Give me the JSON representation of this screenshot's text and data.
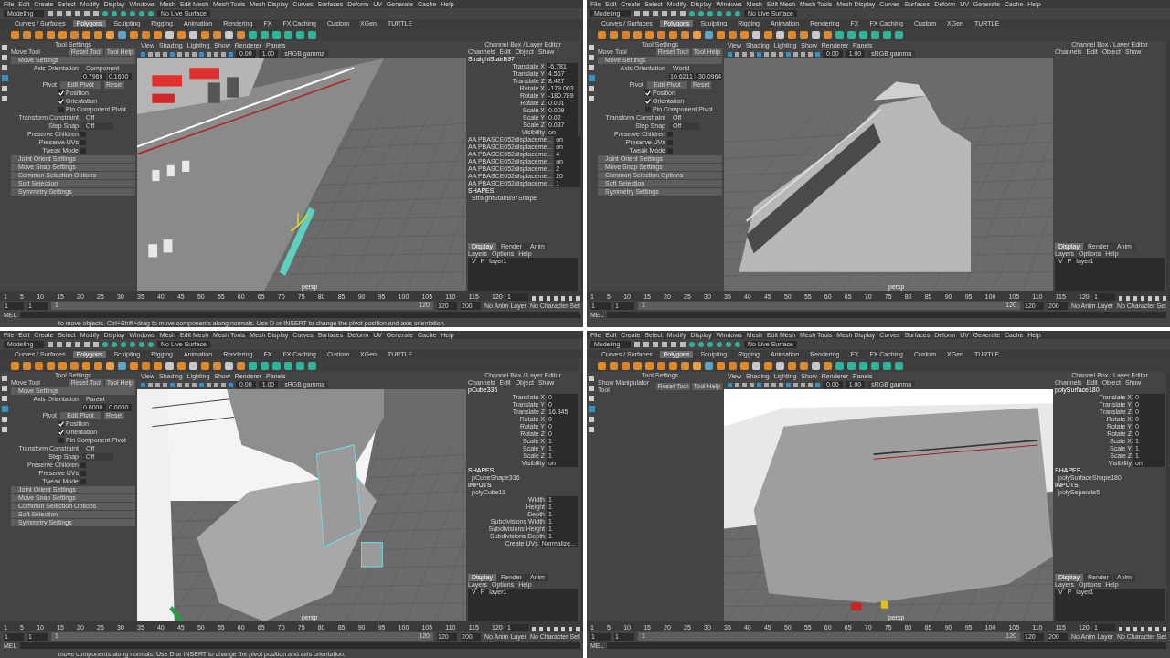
{
  "panels": [
    {
      "kind": "deck",
      "menu": [
        "File",
        "Edit",
        "Create",
        "Select",
        "Modify",
        "Display",
        "Windows",
        "Mesh",
        "Edit Mesh",
        "Mesh Tools",
        "Mesh Display",
        "Curves",
        "Surfaces",
        "Deform",
        "UV",
        "Generate",
        "Cache",
        "Help"
      ],
      "mode": "Modeling",
      "live_surface": "No Live Surface",
      "shelf_tabs": [
        {
          "label": "Curves / Surfaces",
          "selected": false
        },
        {
          "label": "Polygons",
          "selected": true
        },
        {
          "label": "Sculpting",
          "selected": false
        },
        {
          "label": "Rigging",
          "selected": false
        },
        {
          "label": "Animation",
          "selected": false
        },
        {
          "label": "Rendering",
          "selected": false
        },
        {
          "label": "FX",
          "selected": false
        },
        {
          "label": "FX Caching",
          "selected": false
        },
        {
          "label": "Custom",
          "selected": false
        },
        {
          "label": "XGen",
          "selected": false
        },
        {
          "label": "TURTLE",
          "selected": false
        }
      ],
      "tool_settings": {
        "title": "Tool Settings",
        "tool": "Move Tool",
        "buttons": [
          "Reset Tool",
          "Tool Help"
        ],
        "section": "Move Settings",
        "axis_label": "Axis Orientation",
        "axis_value": "Component",
        "axis_values": [
          "0.7969",
          "0.1600"
        ],
        "pivot_label": "Pivot",
        "pivot_buttons": [
          "Edit Pivot",
          "Reset"
        ],
        "checks": [
          {
            "label": "Position",
            "checked": true
          },
          {
            "label": "Orientation",
            "checked": true
          },
          {
            "label": "Pin Component Pivot",
            "checked": false
          }
        ],
        "constraint_label": "Transform Constraint",
        "constraint_value": "Off",
        "snap_label": "Step Snap",
        "snap_value": "Off",
        "preserve": [
          {
            "label": "Preserve Children",
            "checked": false
          },
          {
            "label": "Preserve UVs",
            "checked": false
          },
          {
            "label": "Tweak Mode",
            "checked": false
          }
        ],
        "sections": [
          "Joint Orient Settings",
          "Move Snap Settings",
          "Common Selection Options",
          "Soft Selection",
          "Symmetry Settings"
        ]
      },
      "viewport": {
        "menu": [
          "View",
          "Shading",
          "Lighting",
          "Show",
          "Renderer",
          "Panels"
        ],
        "fields": [
          "0.00",
          "1.00"
        ],
        "gamma": "sRGB gamma",
        "camera": "persp"
      },
      "channel_box": {
        "title": "Channel Box / Layer Editor",
        "menu": [
          "Channels",
          "Edit",
          "Object",
          "Show"
        ],
        "object": "StraightStairB97",
        "channels": [
          {
            "name": "Translate X",
            "value": "-6.781"
          },
          {
            "name": "Translate Y",
            "value": "4.567"
          },
          {
            "name": "Translate Z",
            "value": "8.427"
          },
          {
            "name": "Rotate X",
            "value": "-179.003"
          },
          {
            "name": "Rotate Y",
            "value": "-180.789"
          },
          {
            "name": "Rotate Z",
            "value": "0.001"
          },
          {
            "name": "Scale X",
            "value": "0.009"
          },
          {
            "name": "Scale Y",
            "value": "0.02"
          },
          {
            "name": "Scale Z",
            "value": "0.037"
          },
          {
            "name": "Visibility",
            "value": "on"
          },
          {
            "name": "AA PBASCE052displaceme...",
            "value": "on"
          },
          {
            "name": "AA PBASCE052displaceme...",
            "value": "on"
          },
          {
            "name": "AA PBASCE052displaceme...",
            "value": "4"
          },
          {
            "name": "AA PBASCE052displaceme...",
            "value": "on"
          },
          {
            "name": "AA PBASCE052displaceme...",
            "value": "2"
          },
          {
            "name": "AA PBASCE052displaceme...",
            "value": "20"
          },
          {
            "name": "AA PBASCE052displaceme...",
            "value": "1"
          }
        ],
        "groups": [
          {
            "header": "SHAPES",
            "items": [
              {
                "name": "StraightStairB97Shape"
              }
            ]
          }
        ]
      },
      "layers": {
        "tabs": [
          {
            "label": "Display",
            "selected": true
          },
          {
            "label": "Render",
            "selected": false
          },
          {
            "label": "Anim",
            "selected": false
          }
        ],
        "menu": [
          "Layers",
          "Options",
          "Help"
        ],
        "flags": [
          "V",
          "P"
        ],
        "layer": "layer1"
      },
      "timeline": {
        "ticks": [
          "1",
          "5",
          "10",
          "15",
          "20",
          "25",
          "30",
          "35",
          "40",
          "45",
          "50",
          "55",
          "60",
          "65",
          "70",
          "75",
          "80",
          "85",
          "90",
          "95",
          "100",
          "105",
          "110",
          "115",
          "120"
        ],
        "current": "1",
        "range": [
          "1",
          "1",
          "1",
          "120"
        ],
        "level": 1,
        "end": [
          "120",
          "200"
        ],
        "anim_layer": "No Anim Layer",
        "character_set": "No Character Set",
        "mel": "MEL",
        "help": "to move objects. Ctrl+Shift+drag to move components along normals. Use D or INSERT to change the pivot position and axis orientation."
      }
    },
    {
      "kind": "bow",
      "menu": [
        "File",
        "Edit",
        "Create",
        "Select",
        "Modify",
        "Display",
        "Windows",
        "Mesh",
        "Edit Mesh",
        "Mesh Tools",
        "Mesh Display",
        "Curves",
        "Surfaces",
        "Deform",
        "UV",
        "Generate",
        "Cache",
        "Help"
      ],
      "mode": "Modeling",
      "live_surface": "No Live Surface",
      "shelf_tabs": [
        {
          "label": "Curves / Surfaces",
          "selected": false
        },
        {
          "label": "Polygons",
          "selected": true
        },
        {
          "label": "Sculpting",
          "selected": false
        },
        {
          "label": "Rigging",
          "selected": false
        },
        {
          "label": "Animation",
          "selected": false
        },
        {
          "label": "Rendering",
          "selected": false
        },
        {
          "label": "FX",
          "selected": false
        },
        {
          "label": "FX Caching",
          "selected": false
        },
        {
          "label": "Custom",
          "selected": false
        },
        {
          "label": "XGen",
          "selected": false
        },
        {
          "label": "TURTLE",
          "selected": false
        }
      ],
      "tool_settings": {
        "title": "Tool Settings",
        "tool": "Move Tool",
        "buttons": [
          "Reset Tool",
          "Tool Help"
        ],
        "section": "Move Settings",
        "axis_label": "Axis Orientation",
        "axis_value": "World",
        "axis_values": [
          "10.6211",
          "-30.0964"
        ],
        "pivot_label": "Pivot",
        "pivot_buttons": [
          "Edit Pivot",
          "Reset"
        ],
        "checks": [
          {
            "label": "Position",
            "checked": true
          },
          {
            "label": "Orientation",
            "checked": true
          },
          {
            "label": "Pin Component Pivot",
            "checked": false
          }
        ],
        "constraint_label": "Transform Constraint",
        "constraint_value": "Off",
        "snap_label": "Step Snap",
        "snap_value": "Off",
        "preserve": [
          {
            "label": "Preserve Children",
            "checked": false
          },
          {
            "label": "Preserve UVs",
            "checked": false
          },
          {
            "label": "Tweak Mode",
            "checked": false
          }
        ],
        "sections": [
          "Joint Orient Settings",
          "Move Snap Settings",
          "Common Selection Options",
          "Soft Selection",
          "Symmetry Settings"
        ]
      },
      "viewport": {
        "menu": [
          "View",
          "Shading",
          "Lighting",
          "Show",
          "Renderer",
          "Panels"
        ],
        "fields": [
          "0.00",
          "1.00"
        ],
        "gamma": "sRGB gamma",
        "camera": "persp"
      },
      "channel_box": {
        "title": "Channel Box / Layer Editor",
        "menu": [
          "Channels",
          "Edit",
          "Object",
          "Show"
        ]
      },
      "layers": {
        "tabs": [
          {
            "label": "Display",
            "selected": true
          },
          {
            "label": "Render",
            "selected": false
          },
          {
            "label": "Anim",
            "selected": false
          }
        ],
        "menu": [
          "Layers",
          "Options",
          "Help"
        ],
        "flags": [
          "V",
          "P"
        ],
        "layer": "layer1"
      },
      "timeline": {
        "ticks": [
          "1",
          "5",
          "10",
          "15",
          "20",
          "25",
          "30",
          "35",
          "40",
          "45",
          "50",
          "55",
          "60",
          "65",
          "70",
          "75",
          "80",
          "85",
          "90",
          "95",
          "100",
          "105",
          "110",
          "115",
          "120"
        ],
        "current": "1",
        "range": [
          "1",
          "1",
          "1",
          "120"
        ],
        "level": 1,
        "end": [
          "120",
          "200"
        ],
        "anim_layer": "No Anim Layer",
        "character_set": "No Character Set",
        "mel": "MEL"
      }
    },
    {
      "kind": "stern",
      "menu": [
        "File",
        "Edit",
        "Create",
        "Select",
        "Modify",
        "Display",
        "Windows",
        "Mesh",
        "Edit Mesh",
        "Mesh Tools",
        "Mesh Display",
        "Curves",
        "Surfaces",
        "Deform",
        "UV",
        "Generate",
        "Cache",
        "Help"
      ],
      "mode": "Modeling",
      "live_surface": "No Live Surface",
      "shelf_tabs": [
        {
          "label": "Curves / Surfaces",
          "selected": false
        },
        {
          "label": "Polygons",
          "selected": true
        },
        {
          "label": "Sculpting",
          "selected": false
        },
        {
          "label": "Rigging",
          "selected": false
        },
        {
          "label": "Animation",
          "selected": false
        },
        {
          "label": "Rendering",
          "selected": false
        },
        {
          "label": "FX",
          "selected": false
        },
        {
          "label": "FX Caching",
          "selected": false
        },
        {
          "label": "Custom",
          "selected": false
        },
        {
          "label": "XGen",
          "selected": false
        },
        {
          "label": "TURTLE",
          "selected": false
        }
      ],
      "tool_settings": {
        "title": "Tool Settings",
        "tool": "Move Tool",
        "buttons": [
          "Reset Tool",
          "Tool Help"
        ],
        "section": "Move Settings",
        "axis_label": "Axis Orientation",
        "axis_value": "Parent",
        "axis_values": [
          "0.0000",
          "0.0000"
        ],
        "pivot_label": "Pivot",
        "pivot_buttons": [
          "Edit Pivot",
          "Reset"
        ],
        "checks": [
          {
            "label": "Position",
            "checked": true
          },
          {
            "label": "Orientation",
            "checked": true
          },
          {
            "label": "Pin Component Pivot",
            "checked": false
          }
        ],
        "constraint_label": "Transform Constraint",
        "constraint_value": "Off",
        "snap_label": "Step Snap",
        "snap_value": "Off",
        "preserve": [
          {
            "label": "Preserve Children",
            "checked": false
          },
          {
            "label": "Preserve UVs",
            "checked": false
          },
          {
            "label": "Tweak Mode",
            "checked": false
          }
        ],
        "sections": [
          "Joint Orient Settings",
          "Move Snap Settings",
          "Common Selection Options",
          "Soft Selection",
          "Symmetry Settings"
        ]
      },
      "viewport": {
        "menu": [
          "View",
          "Shading",
          "Lighting",
          "Show",
          "Renderer",
          "Panels"
        ],
        "fields": [
          "0.00",
          "1.00"
        ],
        "gamma": "sRGB gamma",
        "camera": "persp"
      },
      "channel_box": {
        "title": "Channel Box / Layer Editor",
        "menu": [
          "Channels",
          "Edit",
          "Object",
          "Show"
        ],
        "object": "pCube336",
        "channels": [
          {
            "name": "Translate X",
            "value": "0"
          },
          {
            "name": "Translate Y",
            "value": "0"
          },
          {
            "name": "Translate Z",
            "value": "16.845"
          },
          {
            "name": "Rotate X",
            "value": "0"
          },
          {
            "name": "Rotate Y",
            "value": "0"
          },
          {
            "name": "Rotate Z",
            "value": "0"
          },
          {
            "name": "Scale X",
            "value": "1"
          },
          {
            "name": "Scale Y",
            "value": "1"
          },
          {
            "name": "Scale Z",
            "value": "1"
          },
          {
            "name": "Visibility",
            "value": "on"
          }
        ],
        "groups": [
          {
            "header": "SHAPES",
            "items": [
              {
                "name": "pCubeShape336"
              }
            ]
          },
          {
            "header": "INPUTS",
            "items": [
              {
                "name": "polyCube11"
              },
              {
                "name": "Width",
                "value": "1"
              },
              {
                "name": "Height",
                "value": "1"
              },
              {
                "name": "Depth",
                "value": "1"
              },
              {
                "name": "Subdivisions Width",
                "value": "1"
              },
              {
                "name": "Subdivisions Height",
                "value": "1"
              },
              {
                "name": "Subdivisions Depth",
                "value": "1"
              },
              {
                "name": "Create UVs",
                "value": "Normalize..."
              }
            ]
          }
        ]
      },
      "layers": {
        "tabs": [
          {
            "label": "Display",
            "selected": true
          },
          {
            "label": "Render",
            "selected": false
          },
          {
            "label": "Anim",
            "selected": false
          }
        ],
        "menu": [
          "Layers",
          "Options",
          "Help"
        ],
        "flags": [
          "V",
          "P"
        ],
        "layer": "layer1"
      },
      "timeline": {
        "ticks": [
          "1",
          "5",
          "10",
          "15",
          "20",
          "25",
          "30",
          "35",
          "40",
          "45",
          "50",
          "55",
          "60",
          "65",
          "70",
          "75",
          "80",
          "85",
          "90",
          "95",
          "100",
          "105",
          "110",
          "115",
          "120"
        ],
        "current": "1",
        "range": [
          "1",
          "1",
          "1",
          "120"
        ],
        "level": 1,
        "end": [
          "120",
          "200"
        ],
        "anim_layer": "No Anim Layer",
        "character_set": "No Character Set",
        "mel": "MEL",
        "help": "move components along normals. Use D or INSERT to change the pivot position and axis orientation."
      }
    },
    {
      "kind": "hull",
      "menu": [
        "File",
        "Edit",
        "Create",
        "Select",
        "Modify",
        "Display",
        "Windows",
        "Mesh",
        "Edit Mesh",
        "Mesh Tools",
        "Mesh Display",
        "Curves",
        "Surfaces",
        "Deform",
        "UV",
        "Generate",
        "Cache",
        "Help"
      ],
      "mode": "Modeling",
      "live_surface": "No Live Surface",
      "shelf_tabs": [
        {
          "label": "Curves / Surfaces",
          "selected": false
        },
        {
          "label": "Polygons",
          "selected": true
        },
        {
          "label": "Sculpting",
          "selected": false
        },
        {
          "label": "Rigging",
          "selected": false
        },
        {
          "label": "Animation",
          "selected": false
        },
        {
          "label": "Rendering",
          "selected": false
        },
        {
          "label": "FX",
          "selected": false
        },
        {
          "label": "FX Caching",
          "selected": false
        },
        {
          "label": "Custom",
          "selected": false
        },
        {
          "label": "XGen",
          "selected": false
        },
        {
          "label": "TURTLE",
          "selected": false
        }
      ],
      "tool_settings": {
        "title": "Tool Settings",
        "tool": "Show Manipulator Tool",
        "buttons": [
          "Reset Tool",
          "Tool Help"
        ]
      },
      "viewport": {
        "menu": [
          "View",
          "Shading",
          "Lighting",
          "Show",
          "Renderer",
          "Panels"
        ],
        "fields": [
          "0.00",
          "1.00"
        ],
        "gamma": "sRGB gamma",
        "camera": "persp"
      },
      "channel_box": {
        "title": "Channel Box / Layer Editor",
        "menu": [
          "Channels",
          "Edit",
          "Object",
          "Show"
        ],
        "object": "polySurface180",
        "channels": [
          {
            "name": "Translate X",
            "value": "0"
          },
          {
            "name": "Translate Y",
            "value": "0"
          },
          {
            "name": "Translate Z",
            "value": "0"
          },
          {
            "name": "Rotate X",
            "value": "0"
          },
          {
            "name": "Rotate Y",
            "value": "0"
          },
          {
            "name": "Rotate Z",
            "value": "0"
          },
          {
            "name": "Scale X",
            "value": "1"
          },
          {
            "name": "Scale Y",
            "value": "1"
          },
          {
            "name": "Scale Z",
            "value": "1"
          },
          {
            "name": "Visibility",
            "value": "on"
          }
        ],
        "groups": [
          {
            "header": "SHAPES",
            "items": [
              {
                "name": "polySurfaceShape180"
              }
            ]
          },
          {
            "header": "INPUTS",
            "items": [
              {
                "name": "polySeparate5"
              }
            ]
          }
        ]
      },
      "layers": {
        "tabs": [
          {
            "label": "Display",
            "selected": true
          },
          {
            "label": "Render",
            "selected": false
          },
          {
            "label": "Anim",
            "selected": false
          }
        ],
        "menu": [
          "Layers",
          "Options",
          "Help"
        ],
        "flags": [
          "V",
          "P"
        ],
        "layer": "layer1"
      },
      "timeline": {
        "ticks": [
          "1",
          "5",
          "10",
          "15",
          "20",
          "25",
          "30",
          "35",
          "40",
          "45",
          "50",
          "55",
          "60",
          "65",
          "70",
          "75",
          "80",
          "85",
          "90",
          "95",
          "100",
          "105",
          "110",
          "115",
          "120"
        ],
        "current": "1",
        "range": [
          "1",
          "1",
          "1",
          "120"
        ],
        "level": 1,
        "end": [
          "120",
          "200"
        ],
        "anim_layer": "No Anim Layer",
        "character_set": "No Character Set",
        "mel": "MEL"
      }
    }
  ]
}
